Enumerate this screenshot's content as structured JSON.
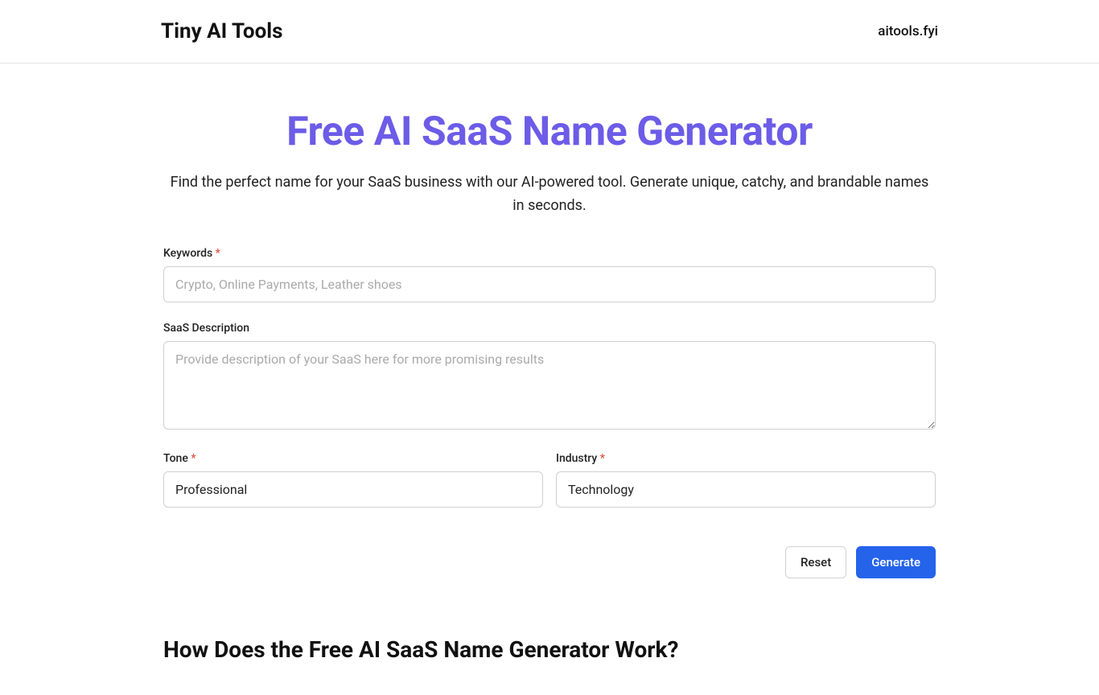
{
  "header": {
    "logo": "Tiny AI Tools",
    "nav_link": "aitools.fyi"
  },
  "hero": {
    "title": "Free AI SaaS Name Generator",
    "subtitle": "Find the perfect name for your SaaS business with our AI-powered tool. Generate unique, catchy, and brandable names in seconds."
  },
  "form": {
    "keywords": {
      "label": "Keywords",
      "required": "*",
      "placeholder": "Crypto, Online Payments, Leather shoes",
      "value": ""
    },
    "description": {
      "label": "SaaS Description",
      "placeholder": "Provide description of your SaaS here for more promising results",
      "value": ""
    },
    "tone": {
      "label": "Tone",
      "required": "*",
      "value": "Professional"
    },
    "industry": {
      "label": "Industry",
      "required": "*",
      "value": "Technology"
    },
    "reset_label": "Reset",
    "generate_label": "Generate"
  },
  "section": {
    "heading": "How Does the Free AI SaaS Name Generator Work?"
  }
}
